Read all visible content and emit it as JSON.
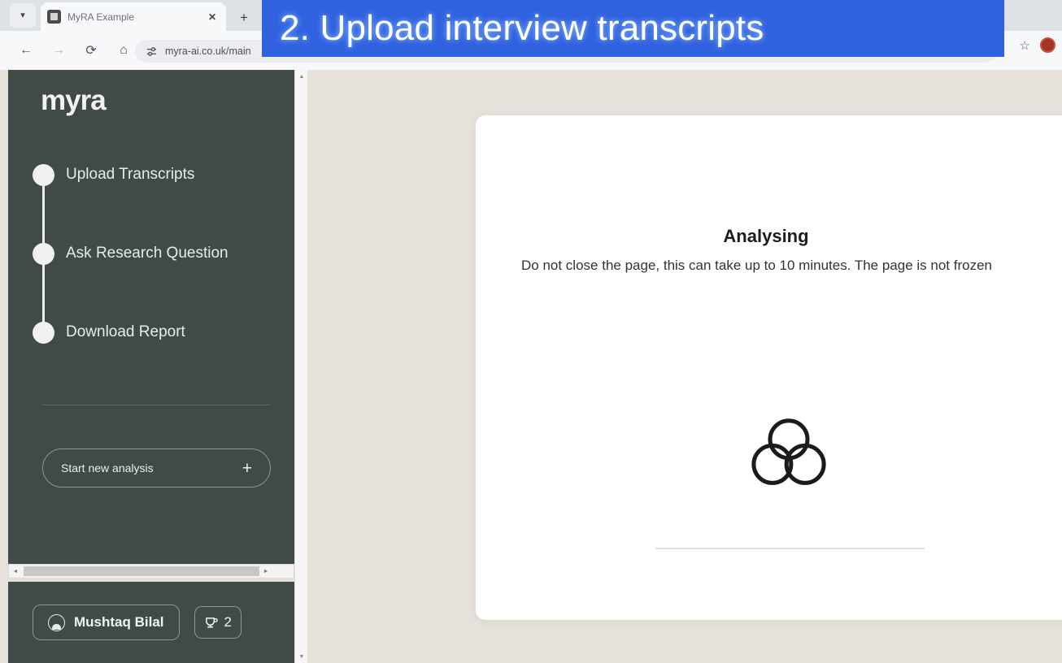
{
  "browser": {
    "tab": {
      "title": "MyRA Example",
      "favicon_icon": "page-favicon",
      "close_icon": "✕"
    },
    "tab_list_icon": "▾",
    "new_tab_icon": "+",
    "back_icon": "←",
    "forward_icon": "→",
    "reload_icon": "⟳",
    "home_icon": "⌂",
    "omnibox": {
      "site_settings_icon": "site-settings-icon",
      "url": "myra-ai.co.uk/main"
    },
    "bookmark_icon": "☆",
    "profile_icon": "profile-avatar"
  },
  "overlay": {
    "text": "2. Upload interview transcripts",
    "background_color": "#3062e0",
    "text_color": "#ffffff"
  },
  "sidebar": {
    "brand": "myra",
    "background_color": "#404b48",
    "steps": [
      {
        "label": "Upload Transcripts"
      },
      {
        "label": "Ask Research Question"
      },
      {
        "label": "Download Report"
      }
    ],
    "new_analysis": {
      "label": "Start new analysis",
      "plus_icon": "+"
    },
    "footer": {
      "user_name": "Mushtaq Bilal",
      "avatar_icon": "user-avatar-icon",
      "credits": {
        "icon": "coffee-cup-icon",
        "count": "2"
      }
    }
  },
  "main": {
    "background_color": "#e6e2db",
    "card": {
      "title": "Analysing",
      "subtitle": "Do not close the page, this can take up to 10 minutes. The page is not frozen",
      "spinner_icon": "borromean-rings-loading-icon"
    }
  },
  "scrollbars": {
    "vertical": {
      "up_icon": "▲",
      "down_icon": "▼"
    },
    "horizontal": {
      "left_icon": "◄",
      "right_icon": "►"
    }
  }
}
